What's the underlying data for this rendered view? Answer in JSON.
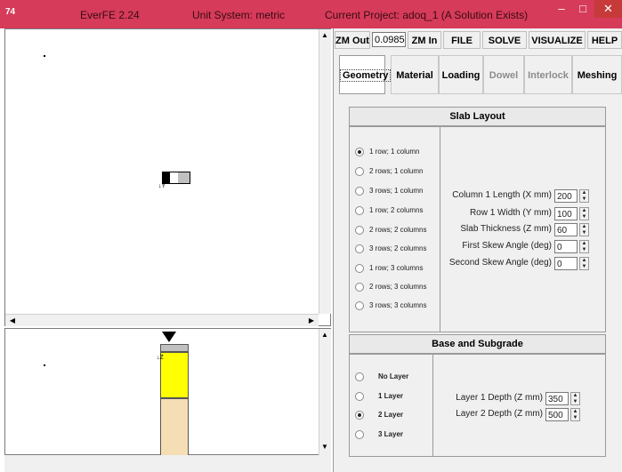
{
  "window": {
    "app_name": "EverFE 2.24",
    "unit_system": "Unit System: metric",
    "project": "Current Project: adoq_1 (A Solution Exists)",
    "title_bar_color": "#d63b5a",
    "icon_text": "74"
  },
  "toolbar": {
    "zoom_out": "ZM Out",
    "zoom_value": "0.0985",
    "zoom_in": "ZM In",
    "file": "FILE",
    "solve": "SOLVE",
    "visualize": "VISUALIZE",
    "help": "HELP"
  },
  "tabs": [
    {
      "label": "Geometry",
      "state": "active"
    },
    {
      "label": "Material",
      "state": "enabled"
    },
    {
      "label": "Loading",
      "state": "enabled"
    },
    {
      "label": "Dowel",
      "state": "disabled"
    },
    {
      "label": "Interlock",
      "state": "disabled"
    },
    {
      "label": "Meshing",
      "state": "enabled"
    }
  ],
  "slab_layout": {
    "title": "Slab Layout",
    "options": [
      "1 row;  1 column",
      "2 rows; 1 column",
      "3 rows; 1 column",
      "1 row;  2 columns",
      "2 rows; 2 columns",
      "3 rows; 2 columns",
      "1 row;  3 columns",
      "2 rows; 3 columns",
      "3 rows; 3 columns"
    ],
    "selected_index": 0,
    "fields": [
      {
        "label": "Column 1 Length (X mm)",
        "value": "200"
      },
      {
        "label": "Row 1 Width (Y mm)",
        "value": "100"
      },
      {
        "label": "Slab Thickness (Z mm)",
        "value": "60"
      },
      {
        "label": "First Skew Angle (deg)",
        "value": "0"
      },
      {
        "label": "Second Skew Angle (deg)",
        "value": "0"
      }
    ]
  },
  "base_subgrade": {
    "title": "Base and Subgrade",
    "options": [
      "No Layer",
      "1 Layer",
      "2 Layer",
      "3 Layer"
    ],
    "selected_index": 2,
    "fields": [
      {
        "label": "Layer 1 Depth (Z mm)",
        "value": "350"
      },
      {
        "label": "Layer 2 Depth (Z mm)",
        "value": "500"
      }
    ]
  },
  "colors": {
    "layer1": "#ffff00",
    "layer2": "#f5deb3",
    "slab": "#c0c0c0"
  },
  "axis_labels": {
    "y": "Y",
    "z": "Z"
  }
}
